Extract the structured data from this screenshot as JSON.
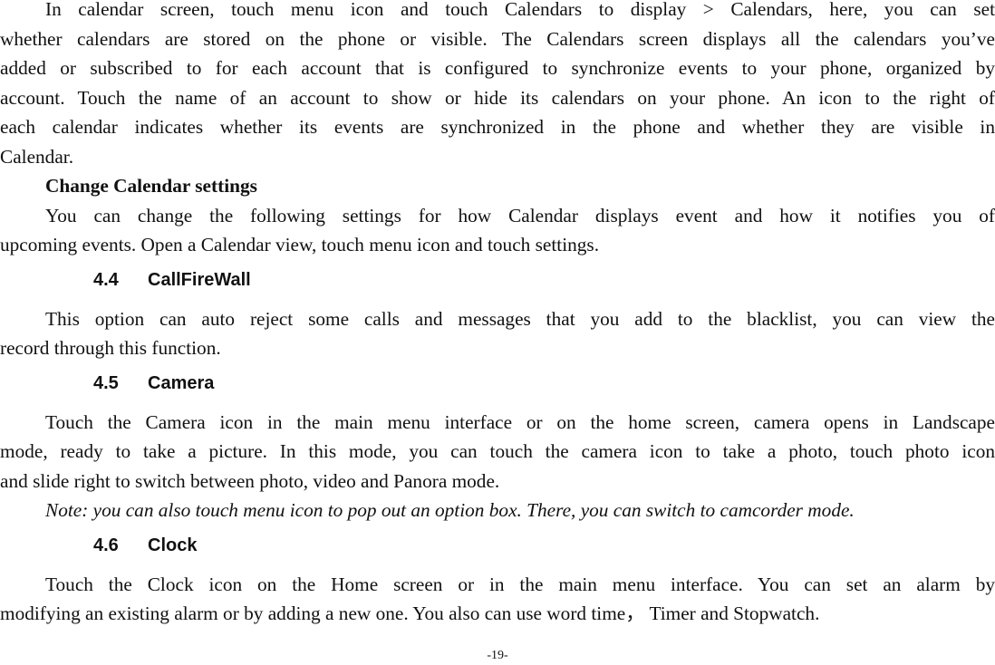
{
  "document": {
    "paragraph_calendars": {
      "lines": [
        "In calendar screen, touch menu icon and touch Calendars to display > Calendars, here, you can set",
        "whether calendars are stored on the phone or visible. The Calendars screen displays all the calendars you’ve",
        "added or subscribed to for each account that is configured to synchronize events to your phone, organized by",
        "account. Touch the name of an account to show or hide its calendars on your phone. An icon to the right of",
        "each calendar indicates whether its events are synchronized in the phone and whether they are visible in",
        "Calendar."
      ]
    },
    "subheading_change_calendar": "Change Calendar settings",
    "paragraph_change_calendar": {
      "lines": [
        "You can change the following settings for how Calendar displays event and how it notifies you of",
        "upcoming events. Open a Calendar view, touch menu icon and touch settings."
      ]
    },
    "section_4_4": {
      "number": "4.4",
      "title": "CallFireWall",
      "lines": [
        "This option can auto reject some calls and messages that you add to the blacklist, you can view the",
        "record through this function."
      ]
    },
    "section_4_5": {
      "number": "4.5",
      "title": "Camera",
      "lines": [
        "Touch the Camera icon in the main menu interface or on the home screen, camera opens in Landscape",
        "mode, ready to take a picture. In this mode, you can touch the camera icon to take a photo, touch photo icon",
        "and slide right to switch between photo, video and Panora mode."
      ],
      "note": "Note: you can also touch menu icon to pop out an option box. There, you can switch to camcorder mode."
    },
    "section_4_6": {
      "number": "4.6",
      "title": "Clock",
      "lines": [
        "Touch the Clock icon on the Home screen or in the main menu interface. You can set an alarm by",
        "modifying an existing alarm or by adding a new one. You also can use word time， Timer and Stopwatch."
      ]
    },
    "page_number": "-19-"
  }
}
